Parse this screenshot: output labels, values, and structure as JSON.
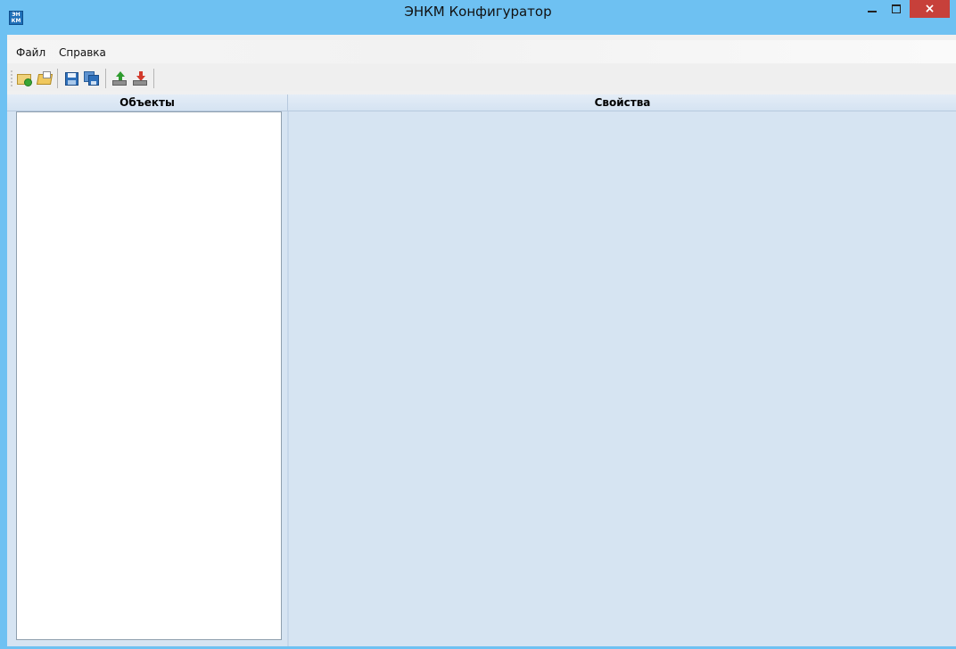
{
  "window": {
    "title": "ЭНКМ Конфигуратор",
    "app_icon_text": "ЭН КМ",
    "close_glyph": "×"
  },
  "menu": {
    "items": [
      {
        "label": "Файл"
      },
      {
        "label": "Справка"
      }
    ]
  },
  "toolbar": {
    "buttons": [
      {
        "icon": "new-folder-icon"
      },
      {
        "icon": "open-folder-icon"
      },
      {
        "icon": "save-icon"
      },
      {
        "icon": "save-all-icon"
      },
      {
        "icon": "upload-icon"
      },
      {
        "icon": "download-icon"
      }
    ]
  },
  "panels": {
    "objects_header": "Объекты",
    "properties_header": "Свойства"
  },
  "colors": {
    "titlebar": "#6ec1f2",
    "close_button": "#c7403a",
    "properties_background": "#d6e4f2",
    "objects_background": "#ffffff"
  }
}
